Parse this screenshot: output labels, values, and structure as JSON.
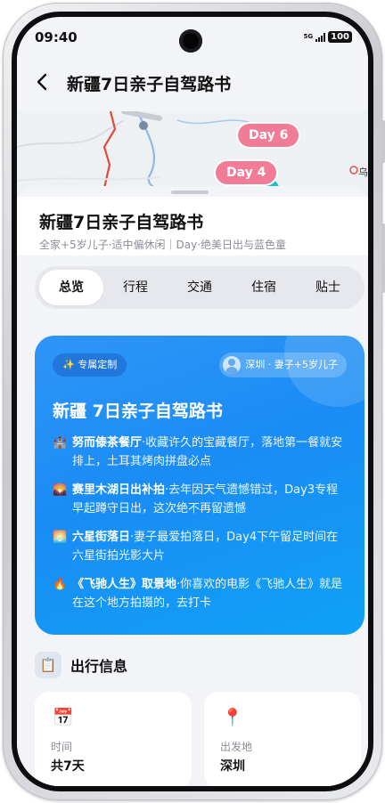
{
  "status_bar": {
    "time": "09:40",
    "network": "5G",
    "battery": "100"
  },
  "header": {
    "title": "新疆7日亲子自驾路书"
  },
  "map": {
    "chips": [
      "Day 6",
      "Day 4"
    ],
    "poi_label": "乌"
  },
  "trip": {
    "title": "新疆7日亲子自驾路书",
    "subtitle": "全家+5岁儿子·适中偏休闲｜Day·绝美日出与蓝色童"
  },
  "tabs": [
    {
      "label": "总览",
      "active": true
    },
    {
      "label": "行程",
      "active": false
    },
    {
      "label": "交通",
      "active": false
    },
    {
      "label": "住宿",
      "active": false
    },
    {
      "label": "贴士",
      "active": false
    }
  ],
  "card": {
    "badge": "专属定制",
    "route": "深圳 · 妻子+5岁儿子",
    "title": "新疆 7日亲子自驾路书",
    "highlights": [
      {
        "icon": "🏰",
        "name": "努而傣茶餐厅",
        "text": "·收藏许久的宝藏餐厅，落地第一餐就安排上，土耳其烤肉拼盘必点"
      },
      {
        "icon": "🌄",
        "name": "赛里木湖日出补拍",
        "text": "·去年因天气遗憾错过，Day3专程早起蹲守日出，这次绝不再留遗憾"
      },
      {
        "icon": "🌅",
        "name": "六星街落日",
        "text": "·妻子最爱拍落日，Day4下午留足时间在六星街拍光影大片"
      },
      {
        "icon": "🔥",
        "name": "《飞驰人生》取景地",
        "text": "·你喜欢的电影《飞驰人生》就是在这个地方拍摄的，去打卡"
      }
    ]
  },
  "info": {
    "title": "出行信息",
    "cards": [
      {
        "icon": "📅",
        "label": "时间",
        "value": "共7天"
      },
      {
        "icon": "📍",
        "label": "出发地",
        "value": "深圳"
      }
    ]
  }
}
